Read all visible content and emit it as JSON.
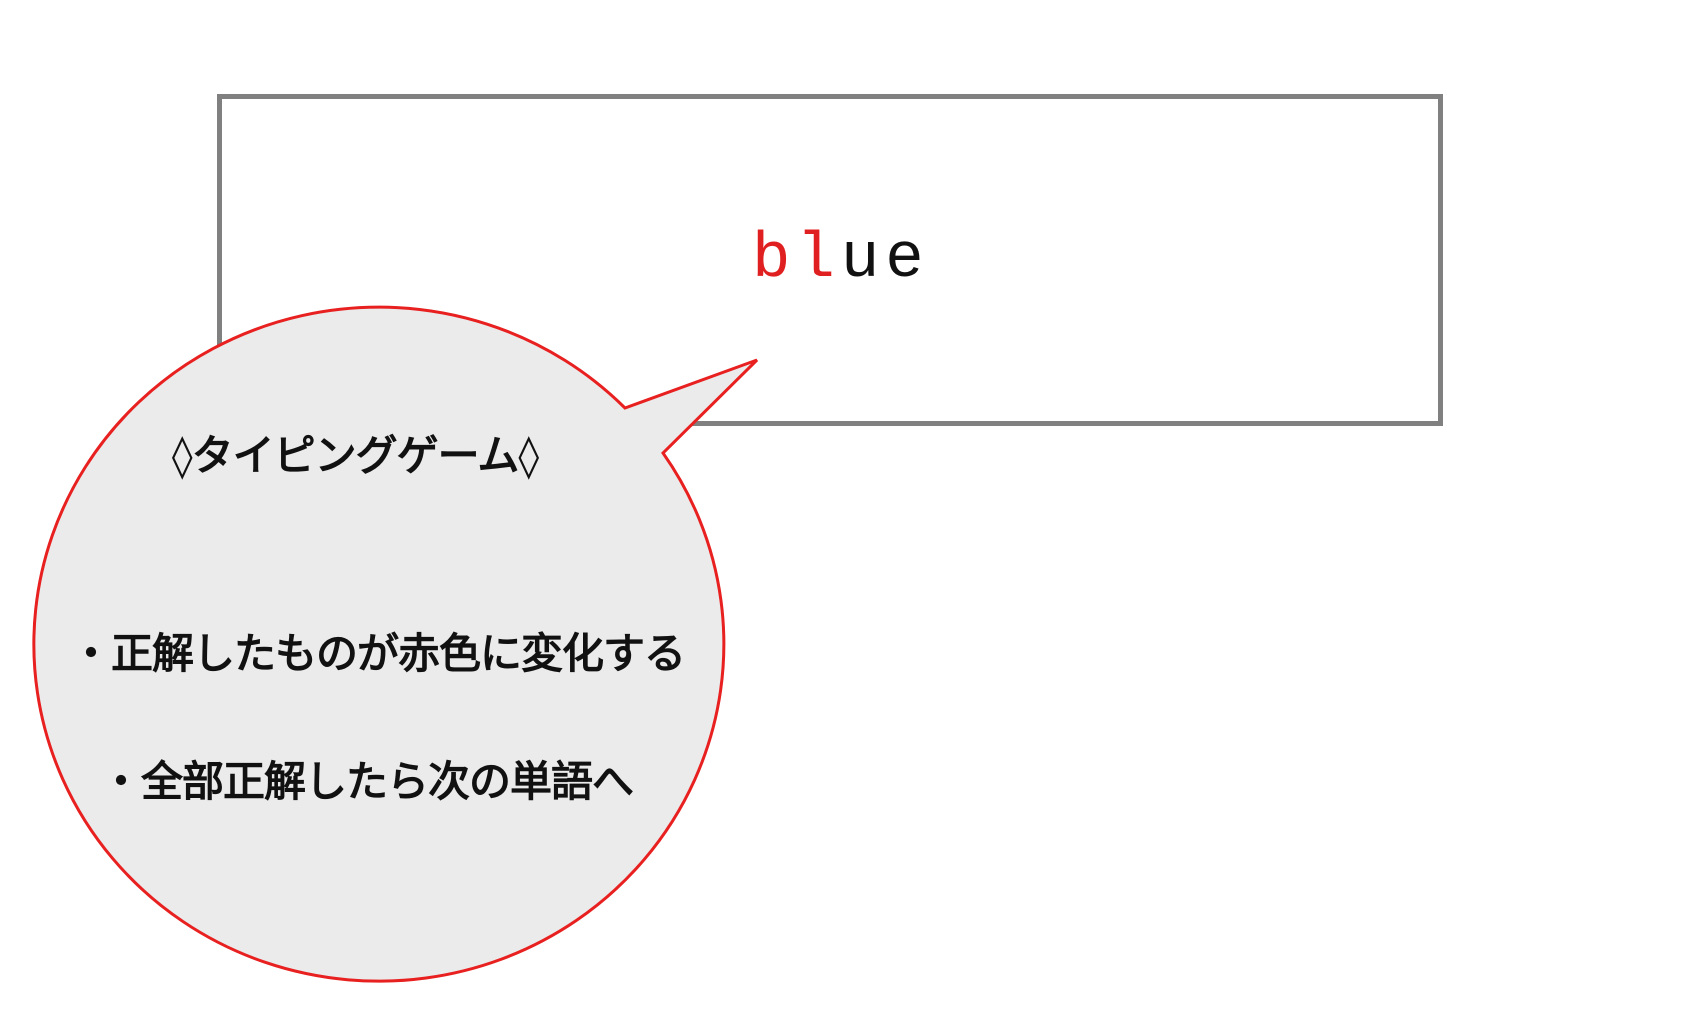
{
  "word": {
    "typed": "bl",
    "remaining": "ue"
  },
  "bubble": {
    "title": "◊タイピングゲーム◊",
    "lines": [
      "・正解したものが赤色に変化する",
      "・全部正解したら次の単語へ"
    ]
  },
  "colors": {
    "typed": "#e02020",
    "remaining": "#111111",
    "panel_border": "#808080",
    "bubble_fill": "#ebebeb",
    "bubble_stroke": "#e82020"
  }
}
